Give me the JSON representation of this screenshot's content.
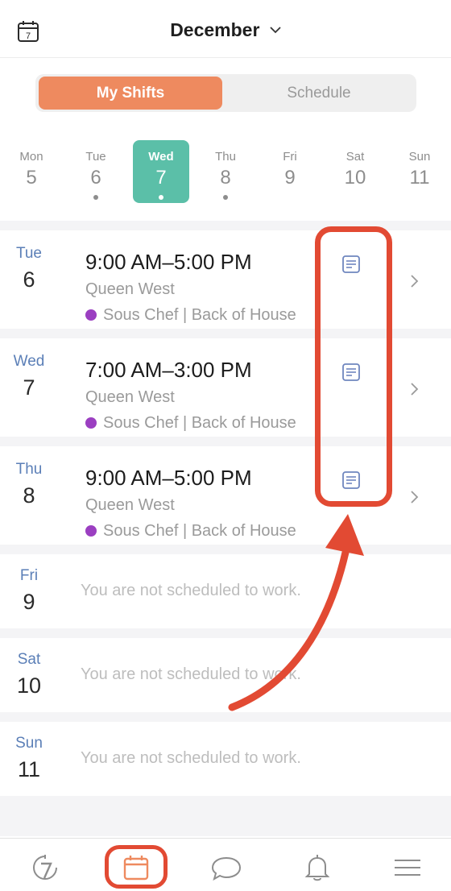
{
  "header": {
    "calendar_icon_number": "7",
    "month": "December"
  },
  "segment": {
    "my_shifts": "My Shifts",
    "schedule": "Schedule"
  },
  "week": [
    {
      "name": "Mon",
      "num": "5",
      "dot": false,
      "selected": false
    },
    {
      "name": "Tue",
      "num": "6",
      "dot": true,
      "selected": false
    },
    {
      "name": "Wed",
      "num": "7",
      "dot": true,
      "selected": true
    },
    {
      "name": "Thu",
      "num": "8",
      "dot": true,
      "selected": false
    },
    {
      "name": "Fri",
      "num": "9",
      "dot": false,
      "selected": false
    },
    {
      "name": "Sat",
      "num": "10",
      "dot": false,
      "selected": false
    },
    {
      "name": "Sun",
      "num": "11",
      "dot": false,
      "selected": false
    }
  ],
  "shifts": [
    {
      "day": "Tue",
      "num": "6",
      "time": "9:00 AM–5:00 PM",
      "location": "Queen West",
      "role": "Sous Chef | Back of House"
    },
    {
      "day": "Wed",
      "num": "7",
      "time": "7:00 AM–3:00 PM",
      "location": "Queen West",
      "role": "Sous Chef | Back of House"
    },
    {
      "day": "Thu",
      "num": "8",
      "time": "9:00 AM–5:00 PM",
      "location": "Queen West",
      "role": "Sous Chef | Back of House"
    }
  ],
  "unscheduled": [
    {
      "day": "Fri",
      "num": "9",
      "text": "You are not scheduled to work."
    },
    {
      "day": "Sat",
      "num": "10",
      "text": "You are not scheduled to work."
    },
    {
      "day": "Sun",
      "num": "11",
      "text": "You are not scheduled to work."
    }
  ],
  "colors": {
    "accent_orange": "#ee8a5f",
    "selected_teal": "#5bbfa8",
    "role_purple": "#9b3fc1",
    "annotation_red": "#e24a33"
  },
  "icons": {
    "tabs": [
      "timeclock-icon",
      "calendar-icon",
      "chat-icon",
      "bell-icon",
      "menu-icon"
    ]
  }
}
